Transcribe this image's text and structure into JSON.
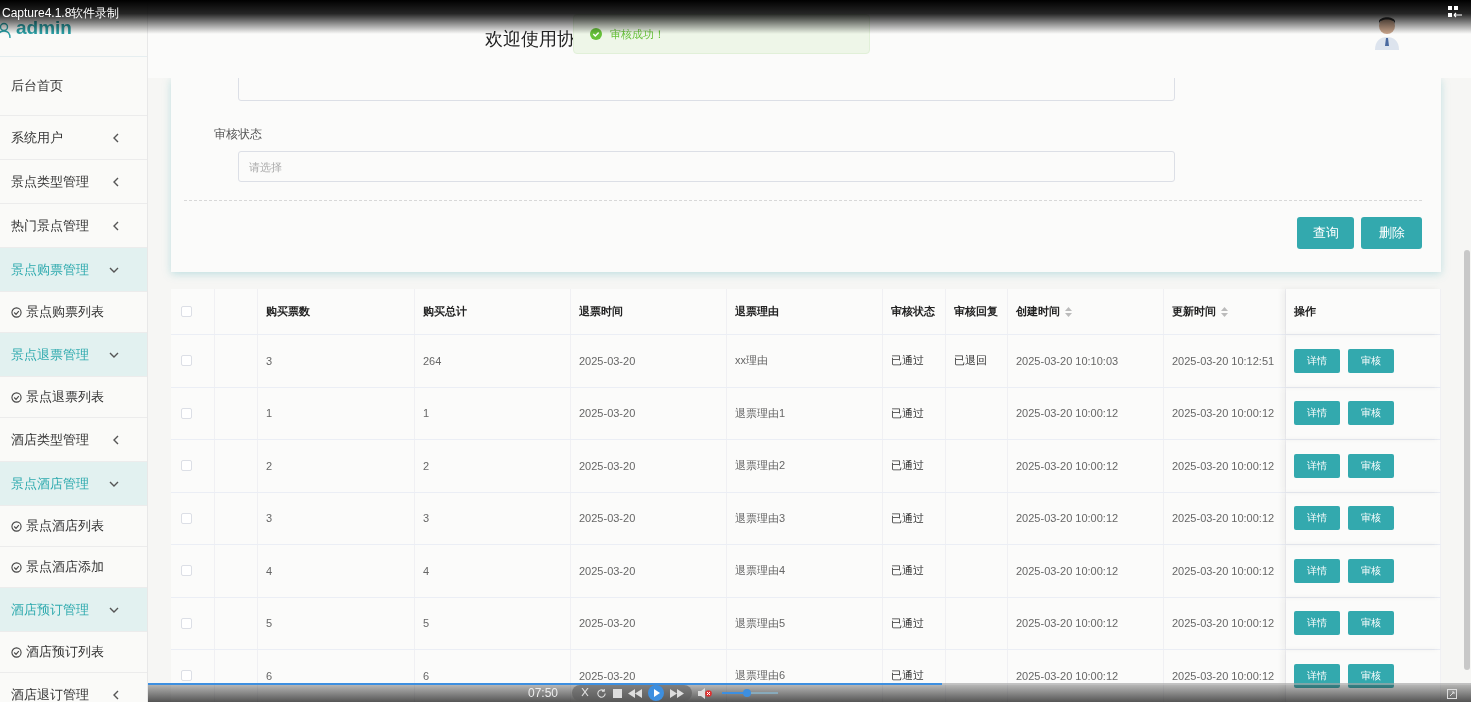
{
  "recorder": {
    "title": "Capture4.1.8软件录制"
  },
  "sidebar": {
    "user": "admin",
    "items": [
      {
        "label": "后台首页",
        "kind": "link"
      },
      {
        "label": "系统用户",
        "kind": "group",
        "expanded": false
      },
      {
        "label": "景点类型管理",
        "kind": "group",
        "expanded": false
      },
      {
        "label": "热门景点管理",
        "kind": "group",
        "expanded": false
      },
      {
        "label": "景点购票管理",
        "kind": "group",
        "expanded": true,
        "children": [
          {
            "label": "景点购票列表"
          }
        ]
      },
      {
        "label": "景点退票管理",
        "kind": "group",
        "expanded": true,
        "children": [
          {
            "label": "景点退票列表"
          }
        ]
      },
      {
        "label": "酒店类型管理",
        "kind": "group",
        "expanded": false
      },
      {
        "label": "景点酒店管理",
        "kind": "group",
        "expanded": true,
        "children": [
          {
            "label": "景点酒店列表"
          },
          {
            "label": "景点酒店添加"
          }
        ]
      },
      {
        "label": "酒店预订管理",
        "kind": "group",
        "expanded": true,
        "children": [
          {
            "label": "酒店预订列表"
          }
        ]
      },
      {
        "label": "酒店退订管理",
        "kind": "group",
        "expanded": false
      }
    ]
  },
  "header": {
    "welcome": "欢迎使用协"
  },
  "toast": {
    "message": "审核成功！"
  },
  "search_form": {
    "fields": [
      {
        "label": "审核状态",
        "placeholder": "请选择"
      }
    ],
    "buttons": [
      "查询",
      "删除"
    ]
  },
  "table": {
    "select_all_checked": false,
    "columns": [
      {
        "label": "购买票数",
        "kind": "plain"
      },
      {
        "label": "购买总计",
        "kind": "plain"
      },
      {
        "label": "退票时间",
        "kind": "plain"
      },
      {
        "label": "退票理由",
        "kind": "plain"
      },
      {
        "label": "审核状态",
        "kind": "plain"
      },
      {
        "label": "审核回复",
        "kind": "plain"
      },
      {
        "label": "创建时间",
        "kind": "sortable"
      },
      {
        "label": "更新时间",
        "kind": "sortable"
      },
      {
        "label": "操作",
        "kind": "plain"
      }
    ],
    "rows": [
      {
        "checked": false,
        "cells": [
          "3",
          "264",
          "2025-03-20",
          "xx理由",
          "已通过",
          "已退回",
          "2025-03-20 10:10:03",
          "2025-03-20 10:12:51"
        ],
        "actions": [
          "详情",
          "审核"
        ]
      },
      {
        "checked": false,
        "cells": [
          "1",
          "1",
          "2025-03-20",
          "退票理由1",
          "已通过",
          null,
          "2025-03-20 10:00:12",
          "2025-03-20 10:00:12"
        ],
        "actions": [
          "详情",
          "审核"
        ]
      },
      {
        "checked": false,
        "cells": [
          "2",
          "2",
          "2025-03-20",
          "退票理由2",
          "已通过",
          null,
          "2025-03-20 10:00:12",
          "2025-03-20 10:00:12"
        ],
        "actions": [
          "详情",
          "审核"
        ]
      },
      {
        "checked": false,
        "cells": [
          "3",
          "3",
          "2025-03-20",
          "退票理由3",
          "已通过",
          null,
          "2025-03-20 10:00:12",
          "2025-03-20 10:00:12"
        ],
        "actions": [
          "详情",
          "审核"
        ]
      },
      {
        "checked": false,
        "cells": [
          "4",
          "4",
          "2025-03-20",
          "退票理由4",
          "已通过",
          null,
          "2025-03-20 10:00:12",
          "2025-03-20 10:00:12"
        ],
        "actions": [
          "详情",
          "审核"
        ]
      },
      {
        "checked": false,
        "cells": [
          "5",
          "5",
          "2025-03-20",
          "退票理由5",
          "已通过",
          null,
          "2025-03-20 10:00:12",
          "2025-03-20 10:00:12"
        ],
        "actions": [
          "详情",
          "审核"
        ]
      },
      {
        "checked": false,
        "cells": [
          "6",
          "6",
          "2025-03-20",
          "退票理由6",
          "已通过",
          null,
          "2025-03-20 10:00:12",
          "2025-03-20 10:00:12"
        ],
        "actions": [
          "详情",
          "审核"
        ]
      }
    ]
  },
  "player": {
    "time": "07:50",
    "progress": {
      "level": 0.6
    },
    "muted": true,
    "volume": {
      "level": 0.45
    }
  }
}
